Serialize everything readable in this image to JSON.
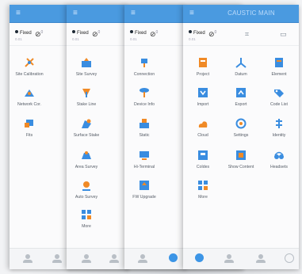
{
  "title": "CAUSTIC MAIN",
  "status": {
    "fix_label": "Fixed",
    "fix_sub": "0.01",
    "sat_count": "0",
    "sat_sub": "11"
  },
  "panels": [
    {
      "items": [
        "Site Calibration",
        "Network Cor.",
        "Fits"
      ]
    },
    {
      "items": [
        "Site Survey",
        "Stake Line",
        "Surface Stake",
        "Area Survey",
        "Auto Survey",
        "More"
      ]
    },
    {
      "items": [
        "Connection",
        "Device Info",
        "Static",
        "Hi-Terminal",
        "FW Upgrade"
      ]
    },
    {
      "items": [
        "Project",
        "Datum",
        "Element",
        "Import",
        "Export",
        "Code List",
        "Cloud",
        "Settings",
        "Identity",
        "Coldes",
        "Show Content",
        "Headsets",
        "More"
      ]
    }
  ],
  "colors": {
    "titlebar": "#4a9ae0",
    "icon_orange": "#f08a26",
    "icon_blue": "#3a8de0",
    "active_tab": "#3c95e6"
  }
}
